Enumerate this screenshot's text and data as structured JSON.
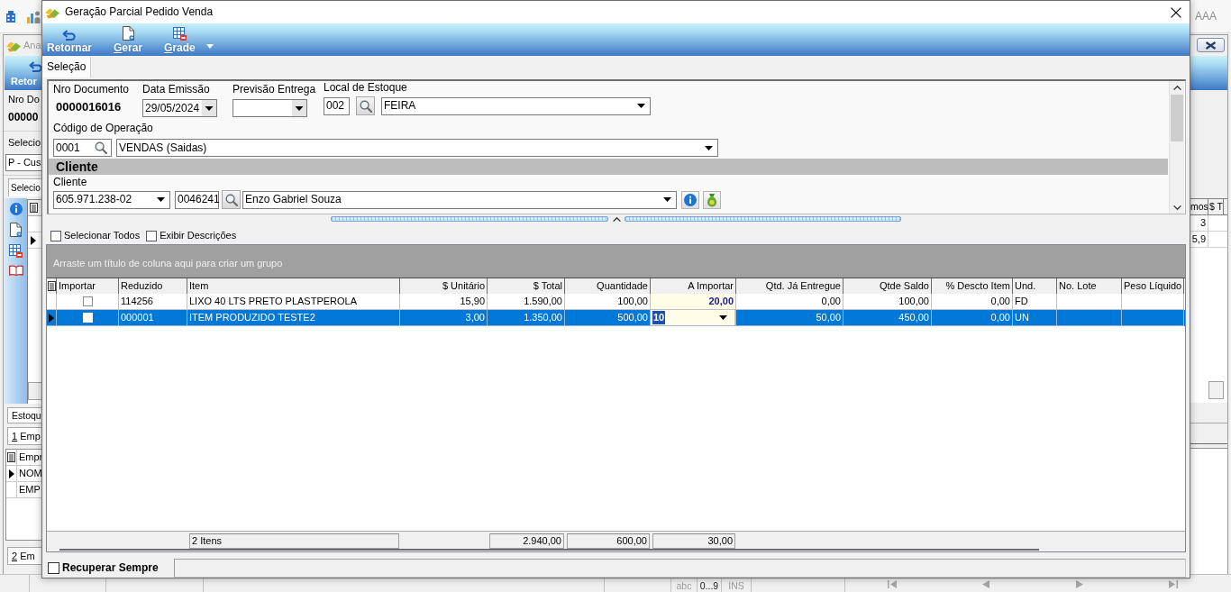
{
  "background_window": {
    "app_toolbar": {
      "label": "AAA"
    },
    "child_window": {
      "title": "Ana",
      "toolbar_button": "Retor",
      "document_label": "Nro Do",
      "document_value": "00000",
      "selection_label": "Selecio",
      "selection_value": "P - Cus",
      "tab": "Selecio",
      "grid": {
        "columns": [
          "mos",
          "$ T"
        ],
        "rows": [
          {
            "selected": false,
            "value": "3"
          },
          {
            "selected": true,
            "value": "5,9"
          }
        ]
      },
      "stock_tab": "Estoqu",
      "sub_tab": {
        "label": "1 Emp",
        "mnemonic": true
      },
      "sub_grid": {
        "column": "Empr",
        "rows": [
          {
            "selected": true,
            "value": "NOM"
          },
          {
            "selected": false,
            "value": "EMP"
          }
        ]
      },
      "second_sub_tab": {
        "label": "2 Em",
        "mnemonic": true
      }
    },
    "status_bar": [
      {
        "label": "abc",
        "active": false
      },
      {
        "label": "0...9",
        "active": true
      },
      {
        "label": "INS",
        "active": false
      }
    ]
  },
  "dialog": {
    "title": "Geração Parcial Pedido Venda",
    "toolbar": [
      {
        "label": "Retornar",
        "kind": "return",
        "mnemonic": false,
        "menu": false
      },
      {
        "label": "Gerar",
        "kind": "generate",
        "mnemonic": true,
        "menu": false
      },
      {
        "label": "Grade",
        "kind": "grid",
        "mnemonic": true,
        "menu": true
      }
    ],
    "tabs": [
      {
        "label": "Seleção",
        "selected": true
      }
    ],
    "form": {
      "document_number": {
        "label": "Nro Documento",
        "value": "0000016016"
      },
      "issue_date": {
        "label": "Data Emissão",
        "value": "29/05/2024"
      },
      "delivery_forecast": {
        "label": "Previsão Entrega"
      },
      "stock_location": {
        "label": "Local de Estoque",
        "code": "002",
        "name": "FEIRA"
      },
      "operation": {
        "label": "Código de Operação",
        "code": "0001",
        "name": "VENDAS (Saidas)"
      },
      "client": {
        "section_title": "Cliente",
        "label": "Cliente",
        "document": "605.971.238-02",
        "code": "0046241",
        "name": "Enzo Gabriel Souza"
      }
    },
    "options": [
      {
        "label": "Selecionar Todos",
        "checked": false
      },
      {
        "label": "Exibir Descrições",
        "checked": false
      }
    ],
    "grid": {
      "group_hint": "Arraste um título de coluna aqui para criar um grupo",
      "columns": [
        {
          "label": "Importar",
          "kind": "check"
        },
        {
          "label": "Reduzido",
          "kind": "text"
        },
        {
          "label": "Item",
          "kind": "text",
          "summary": "2 Itens"
        },
        {
          "label": "$ Unitário",
          "kind": "number"
        },
        {
          "label": "$ Total",
          "kind": "number",
          "summary": "2.940,00"
        },
        {
          "label": "Quantidade",
          "kind": "number",
          "summary": "600,00"
        },
        {
          "label": "A Importar",
          "kind": "input",
          "summary": "30,00"
        },
        {
          "label": "Qtd. Já Entregue",
          "kind": "number"
        },
        {
          "label": "Qtde Saldo",
          "kind": "number"
        },
        {
          "label": "% Descto Item",
          "kind": "number"
        },
        {
          "label": "Und.",
          "kind": "text"
        },
        {
          "label": "No. Lote",
          "kind": "text"
        },
        {
          "label": "Peso Líquido",
          "kind": "text"
        }
      ],
      "rows": [
        {
          "selected": false,
          "editing": false,
          "cells": [
            {
              "checked": false
            },
            "114256",
            "LIXO 40 LTS PRETO PLASTPEROLA",
            "15,90",
            "1.590,00",
            "100,00",
            "20,00",
            "0,00",
            "100,00",
            "0,00",
            "FD"
          ]
        },
        {
          "selected": true,
          "editing": true,
          "cells": [
            {
              "checked": false
            },
            "000001",
            "ITEM PRODUZIDO TESTE2",
            "3,00",
            "1.350,00",
            "500,00",
            "10",
            "50,00",
            "450,00",
            "0,00",
            "UN"
          ]
        }
      ]
    },
    "bottom_option": {
      "label": "Recuperar Sempre",
      "checked": false
    }
  }
}
